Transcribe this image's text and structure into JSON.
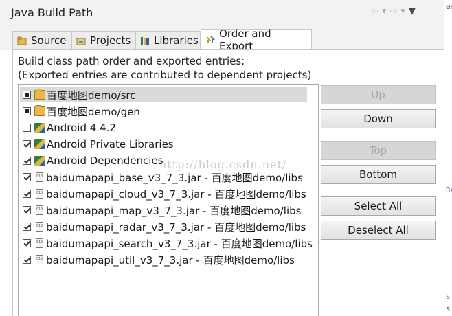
{
  "dialog": {
    "title": "Java Build Path"
  },
  "tabs": [
    {
      "label": "Source",
      "icon": "source-folder-icon"
    },
    {
      "label": "Projects",
      "icon": "projects-icon"
    },
    {
      "label": "Libraries",
      "icon": "libraries-icon"
    },
    {
      "label": "Order and Export",
      "icon": "order-export-icon",
      "active": true
    }
  ],
  "description": {
    "line1": "Build class path order and exported entries:",
    "line2": "(Exported entries are contributed to dependent projects)"
  },
  "entries": [
    {
      "label": "百度地图demo/src",
      "state": "partial",
      "icon": "source-folder-icon",
      "selected": true
    },
    {
      "label": "百度地图demo/gen",
      "state": "partial",
      "icon": "source-folder-icon"
    },
    {
      "label": "Android 4.4.2",
      "state": "unchecked",
      "icon": "library-icon"
    },
    {
      "label": "Android Private Libraries",
      "state": "checked",
      "icon": "library-icon"
    },
    {
      "label": "Android Dependencies",
      "state": "checked",
      "icon": "library-icon"
    },
    {
      "label": "baidumapapi_base_v3_7_3.jar - 百度地图demo/libs",
      "state": "checked",
      "icon": "jar-icon"
    },
    {
      "label": "baidumapapi_cloud_v3_7_3.jar - 百度地图demo/libs",
      "state": "checked",
      "icon": "jar-icon"
    },
    {
      "label": "baidumapapi_map_v3_7_3.jar - 百度地图demo/libs",
      "state": "checked",
      "icon": "jar-icon"
    },
    {
      "label": "baidumapapi_radar_v3_7_3.jar - 百度地图demo/libs",
      "state": "checked",
      "icon": "jar-icon"
    },
    {
      "label": "baidumapapi_search_v3_7_3.jar - 百度地图demo/libs",
      "state": "checked",
      "icon": "jar-icon"
    },
    {
      "label": "baidumapapi_util_v3_7_3.jar - 百度地图demo/libs",
      "state": "checked",
      "icon": "jar-icon"
    }
  ],
  "buttons": {
    "up": "Up",
    "down": "Down",
    "top": "Top",
    "bottom": "Bottom",
    "select_all": "Select All",
    "deselect_all": "Deselect All"
  },
  "watermark": "http://blog.csdn.net/",
  "edge_text": {
    "a": "er",
    "b": "RA",
    "c": "s",
    "d": "s"
  },
  "colors": {
    "selection": "#dadada",
    "disabled_button": "#d6d6d6",
    "folder": "#e8b84a"
  }
}
